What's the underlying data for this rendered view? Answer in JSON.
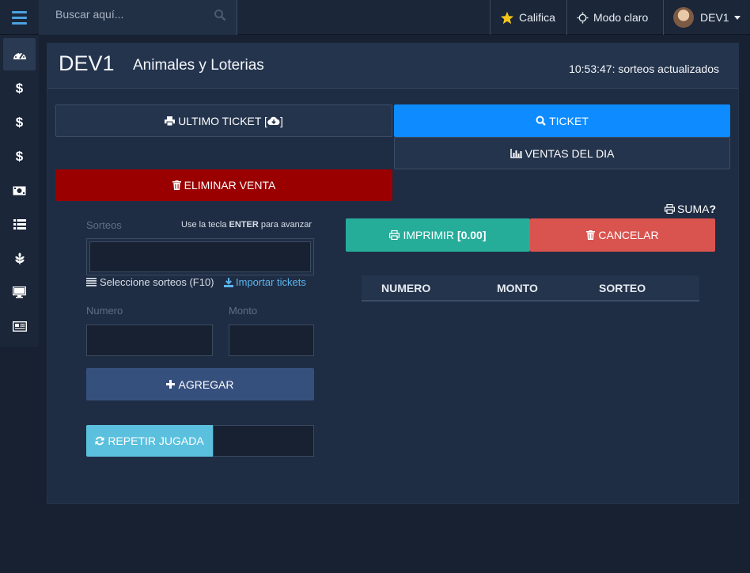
{
  "topbar": {
    "search_placeholder": "Buscar aquí...",
    "califica": "Califica",
    "modo": "Modo claro",
    "user": "DEV1"
  },
  "sidebar": {
    "items": [
      "dashboard-icon",
      "dollar-icon",
      "dollar-icon",
      "dollar-icon",
      "money-icon",
      "list-icon",
      "leaf-icon",
      "monitor-icon",
      "newspaper-icon"
    ],
    "dollar": "$"
  },
  "panel": {
    "title": "DEV1",
    "subtitle": "Animales y Loterias",
    "status": "10:53:47: sorteos actualizados"
  },
  "buttons": {
    "ultimo_ticket": "ULTIMO TICKET [",
    "ultimo_ticket_end": "]",
    "ticket": "TICKET",
    "ventas": "VENTAS DEL DIA",
    "eliminar": "ELIMINAR VENTA",
    "suma": "SUMA",
    "suma_q": "?",
    "imprimir": "IMPRIMIR ",
    "imprimir_total": "[0.00]",
    "cancelar": "CANCELAR",
    "agregar": "AGREGAR",
    "repetir": "REPETIR JUGADA"
  },
  "form": {
    "sorteos_label": "Sorteos",
    "hint_pre": "Use la tecla ",
    "hint_key": "ENTER",
    "hint_post": " para avanzar",
    "seleccione": "Seleccione sorteos (F10)",
    "importar": "Importar tickets",
    "numero_label": "Numero",
    "monto_label": "Monto"
  },
  "table": {
    "columns": [
      "NUMERO",
      "MONTO",
      "SORTEO"
    ]
  },
  "colors": {
    "primary": "#0d8bff",
    "danger": "#9b0000",
    "success": "#26ad9a",
    "cancel": "#d9534f",
    "info": "#5bc0de",
    "accent": "#4aa3e0"
  }
}
